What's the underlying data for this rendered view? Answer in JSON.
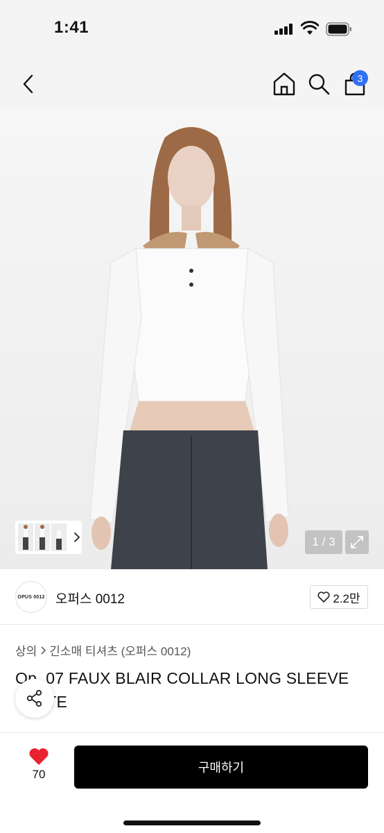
{
  "status": {
    "time": "1:41"
  },
  "header": {
    "cart_count": "3"
  },
  "gallery": {
    "page_indicator": "1 / 3",
    "thumb_logo_text": "OPUS 0012"
  },
  "store": {
    "logo_text": "OPUS 0012",
    "name": "오퍼스 0012",
    "likes": "2.2만"
  },
  "breadcrumb": {
    "items": [
      "상의",
      "긴소매 티셔츠 (오퍼스 0012)"
    ]
  },
  "product": {
    "title": "Op. 07 FAUX BLAIR COLLAR LONG SLEEVE WHITE"
  },
  "bottom": {
    "heart_count": "70",
    "buy_label": "구매하기"
  },
  "colors": {
    "accent": "#2f6ff2",
    "heart": "#e8232f",
    "buy": "#000000"
  }
}
